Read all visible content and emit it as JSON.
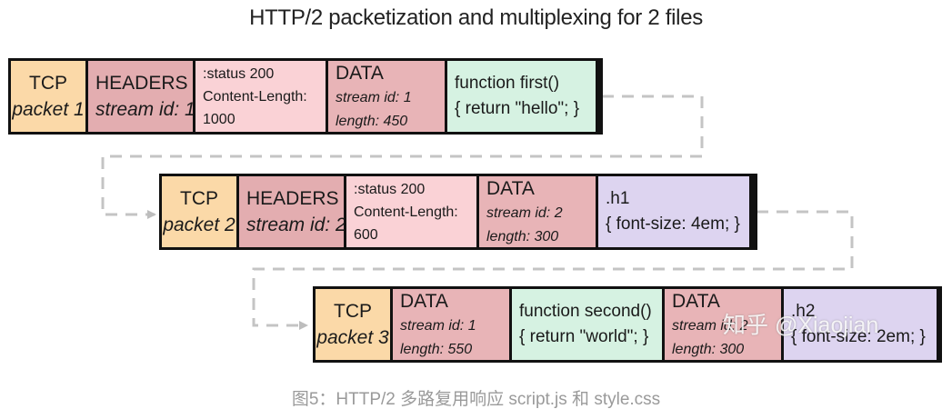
{
  "title": "HTTP/2 packetization and multiplexing for 2 files",
  "caption": "图5：HTTP/2 多路复用响应 script.js 和 style.css",
  "watermark": "知乎 @Xiaojian",
  "packets": [
    {
      "tcp": {
        "label": "TCP",
        "sub": "packet 1"
      },
      "headers": {
        "label": "HEADERS",
        "sub": "stream id: 1"
      },
      "meta": {
        "l1": ":status 200",
        "l2": "Content-Length:",
        "l3": "1000"
      },
      "data": {
        "label": "DATA",
        "stream": "stream id: 1",
        "length": "length: 450"
      },
      "payload": {
        "l1": "function first()",
        "l2": "{ return \"hello\"; }"
      }
    },
    {
      "tcp": {
        "label": "TCP",
        "sub": "packet 2"
      },
      "headers": {
        "label": "HEADERS",
        "sub": "stream id: 2"
      },
      "meta": {
        "l1": ":status 200",
        "l2": "Content-Length:",
        "l3": "600"
      },
      "data": {
        "label": "DATA",
        "stream": "stream id: 2",
        "length": "length: 300"
      },
      "payload": {
        "l1": ".h1",
        "l2": "{ font-size: 4em; }"
      }
    },
    {
      "tcp": {
        "label": "TCP",
        "sub": "packet 3"
      },
      "data1": {
        "label": "DATA",
        "stream": "stream id: 1",
        "length": "length: 550"
      },
      "payload1": {
        "l1": "function second()",
        "l2": "{ return \"world\"; }"
      },
      "data2": {
        "label": "DATA",
        "stream": "stream id: 2",
        "length": "length: 300"
      },
      "payload2": {
        "l1": ".h2",
        "l2": "{ font-size: 2em; }"
      }
    }
  ]
}
